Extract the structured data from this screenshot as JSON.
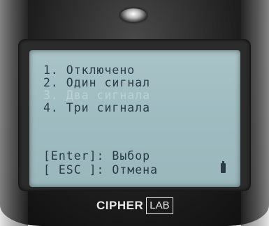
{
  "menu": {
    "items": [
      {
        "label": "1. Отключено"
      },
      {
        "label": "2. Один сигнал"
      },
      {
        "label": "3. Два сигнала",
        "selected": true
      },
      {
        "label": "4. Три сигнала"
      }
    ]
  },
  "hints": {
    "enter": "[Enter]: Выбор",
    "esc": "[ ESC ]: Отмена"
  },
  "brand": {
    "left": "CIPHER",
    "right": "LAB"
  },
  "colors": {
    "lcd": "#a9c3c7",
    "lcd_text": "#2a3a44",
    "highlight": "#2c3c46"
  }
}
